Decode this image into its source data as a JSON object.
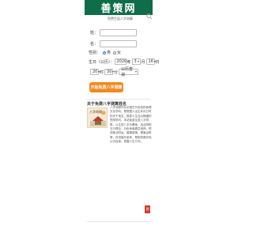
{
  "header": {
    "logo_text": "善策网"
  },
  "subtitle": "免费生辰八字测算",
  "form": {
    "surname_label": "姓：",
    "name_label": "名：",
    "gender_label": "性别：",
    "gender_male": "男",
    "gender_female": "女",
    "birth_label": "生日（公历）：",
    "year_value": "2020",
    "year_unit": "年",
    "month_value": "3",
    "month_unit": "月",
    "day_value": "16",
    "day_unit": "日",
    "hour_value": "20",
    "hour_unit": "时",
    "minute_value": "30",
    "minute_unit": "分",
    "calendar_value": "公历查询",
    "submit_label": "开始免费八字测算"
  },
  "about": {
    "title": "关于免费八字测算姓名",
    "thumb_text": "八字命理",
    "text": "八字测算作为中国古代传统的命理文化学科，是根据人出生年月日时的天干地支，推算人生吉凶祸福的预测学问。本站免费生辰八字测算，以生辰八字为基础，结合阴阳五行理论，分析命局喜忌用神，预测事业财运、婚姻感情、健康运势等，仅供娱乐参考，帮助您更好地认识自我、把握人生方向。"
  },
  "badge": "测"
}
